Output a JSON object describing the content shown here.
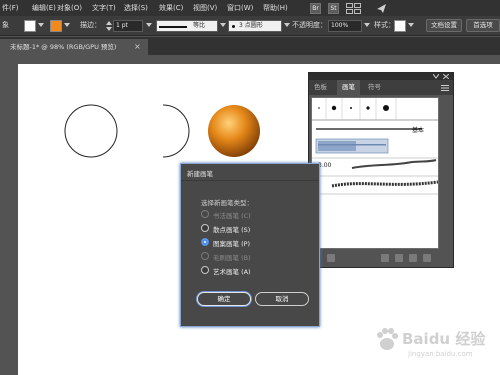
{
  "menubar": {
    "items": [
      "件(F)",
      "编辑(E)",
      "对象(O)",
      "文字(T)",
      "选择(S)",
      "效果(C)",
      "视图(V)",
      "窗口(W)",
      "帮助(H)"
    ],
    "icons": [
      "Br",
      "St"
    ]
  },
  "controlbar": {
    "left_label": "象",
    "stroke_label": "描边：",
    "stroke_value": "1 pt",
    "profile_label": "等比",
    "brush_value": "3 点圆形",
    "opacity_label": "不透明度：",
    "opacity_value": "100%",
    "style_label": "样式：",
    "doc_setup_label": "文档设置",
    "prefs_label": "首选项"
  },
  "tab": {
    "title": "未标题-1* @ 98% (RGB/GPU 预览)",
    "close": "×"
  },
  "panel": {
    "tabs": [
      "色板",
      "画笔",
      "符号"
    ],
    "active_tab": 1,
    "basic_label": "基本",
    "size_label": "3.00"
  },
  "dialog": {
    "title": "新建画笔",
    "prompt": "选择新画笔类型：",
    "options": [
      {
        "label": "书法画笔 (C)",
        "enabled": false,
        "selected": false
      },
      {
        "label": "散点画笔 (S)",
        "enabled": true,
        "selected": false
      },
      {
        "label": "图案画笔 (P)",
        "enabled": true,
        "selected": true
      },
      {
        "label": "毛刷画笔 (B)",
        "enabled": false,
        "selected": false
      },
      {
        "label": "艺术画笔 (A)",
        "enabled": true,
        "selected": false
      }
    ],
    "ok_label": "确定",
    "cancel_label": "取消"
  },
  "colors": {
    "sphere_light": "#ffd27a",
    "sphere_mid": "#e6891a",
    "sphere_dark": "#7a3a05",
    "accent_blue": "#4f8ee6"
  },
  "watermark": {
    "text": "Baidu 经验",
    "url": "jingyan.baidu.com"
  }
}
